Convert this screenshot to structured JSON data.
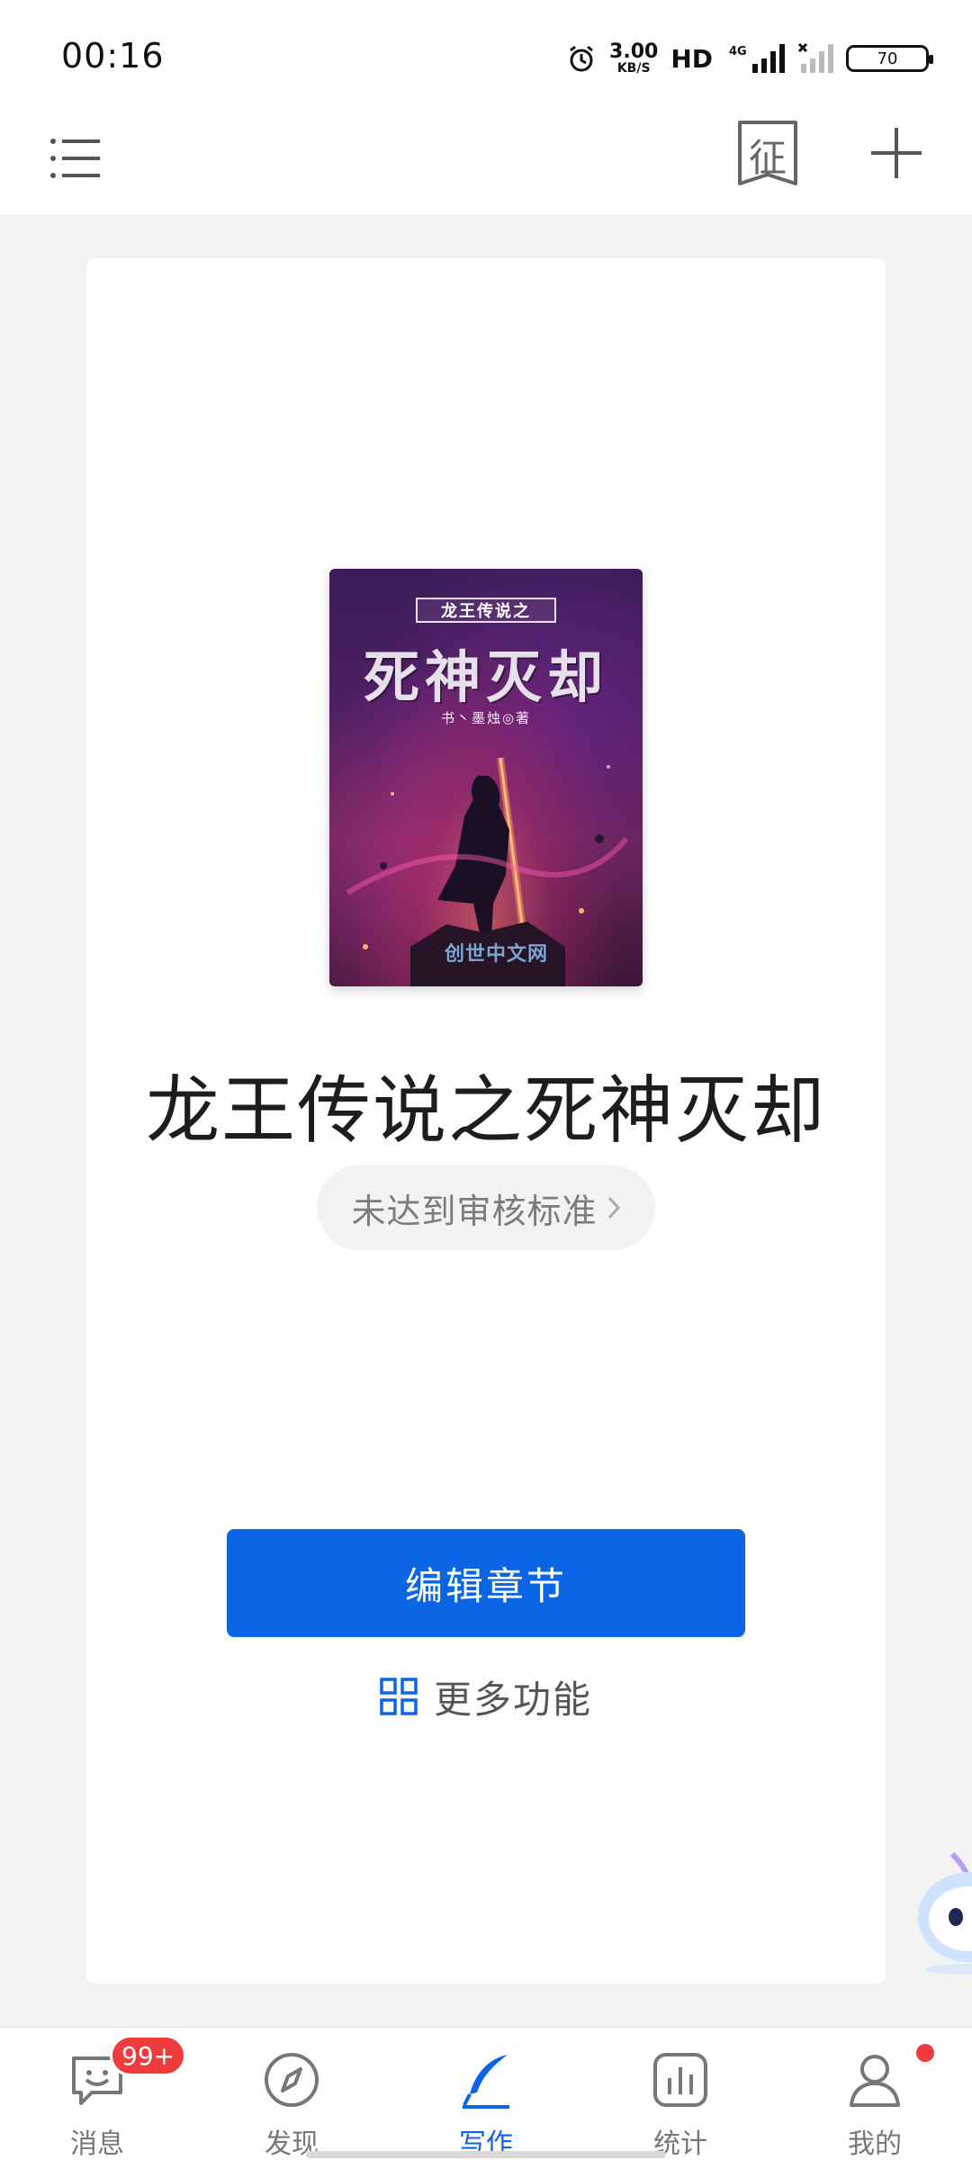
{
  "status_bar": {
    "time": "00:16",
    "speed_value": "3.00",
    "speed_unit": "KB/S",
    "hd_label": "HD",
    "network_label": "4G",
    "battery": "70"
  },
  "header": {
    "zheng_label": "征",
    "menu_icon": "list-icon",
    "add_icon": "plus-icon"
  },
  "book": {
    "cover_series_label": "龙王传说之",
    "cover_title": "死神灭却",
    "cover_author": "书丶墨烛◎著",
    "cover_watermark": "创世中文网",
    "title": "龙王传说之死神灭却",
    "review_status": "未达到审核标准"
  },
  "actions": {
    "edit_label": "编辑章节",
    "more_label": "更多功能"
  },
  "bottom_nav": {
    "items": [
      {
        "label": "消息",
        "icon": "message-icon",
        "badge": "99+"
      },
      {
        "label": "发现",
        "icon": "compass-icon"
      },
      {
        "label": "写作",
        "icon": "feather-pen-icon",
        "active": true
      },
      {
        "label": "统计",
        "icon": "stats-icon"
      },
      {
        "label": "我的",
        "icon": "user-icon",
        "dot": true
      }
    ]
  },
  "colors": {
    "accent": "#0a66e4",
    "badge": "#ee3b3b",
    "background": "#f3f3f3"
  }
}
